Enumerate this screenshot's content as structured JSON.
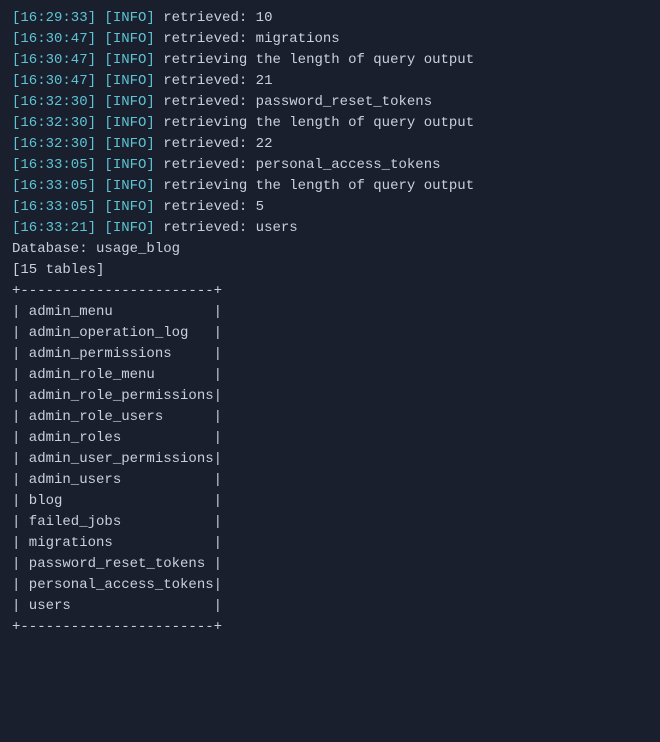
{
  "terminal": {
    "background": "#1a1f2e",
    "log_lines": [
      {
        "timestamp": "[16:29:33]",
        "level": "[INFO]",
        "message": " retrieved: 10"
      },
      {
        "timestamp": "[16:30:47]",
        "level": "[INFO]",
        "message": " retrieved: migrations"
      },
      {
        "timestamp": "[16:30:47]",
        "level": "[INFO]",
        "message": " retrieving the length of query output"
      },
      {
        "timestamp": "[16:30:47]",
        "level": "[INFO]",
        "message": " retrieved: 21"
      },
      {
        "timestamp": "[16:32:30]",
        "level": "[INFO]",
        "message": " retrieved: password_reset_tokens"
      },
      {
        "timestamp": "[16:32:30]",
        "level": "[INFO]",
        "message": " retrieving the length of query output"
      },
      {
        "timestamp": "[16:32:30]",
        "level": "[INFO]",
        "message": " retrieved: 22"
      },
      {
        "timestamp": "[16:33:05]",
        "level": "[INFO]",
        "message": " retrieved: personal_access_tokens"
      },
      {
        "timestamp": "[16:33:05]",
        "level": "[INFO]",
        "message": " retrieving the length of query output"
      },
      {
        "timestamp": "[16:33:05]",
        "level": "[INFO]",
        "message": " retrieved: 5"
      },
      {
        "timestamp": "[16:33:21]",
        "level": "[INFO]",
        "message": " retrieved: users"
      }
    ],
    "db_line": "Database: usage_blog",
    "tables_count_line": "[15 tables]",
    "table_top_border": "+-----------------------+",
    "table_bottom_border": "+-----------------------+",
    "tables": [
      "| admin_menu            |",
      "| admin_operation_log   |",
      "| admin_permissions     |",
      "| admin_role_menu       |",
      "| admin_role_permissions|",
      "| admin_role_users      |",
      "| admin_roles           |",
      "| admin_user_permissions|",
      "| admin_users           |",
      "| blog                  |",
      "| failed_jobs           |",
      "| migrations            |",
      "| password_reset_tokens |",
      "| personal_access_tokens|",
      "| users                 |"
    ]
  }
}
